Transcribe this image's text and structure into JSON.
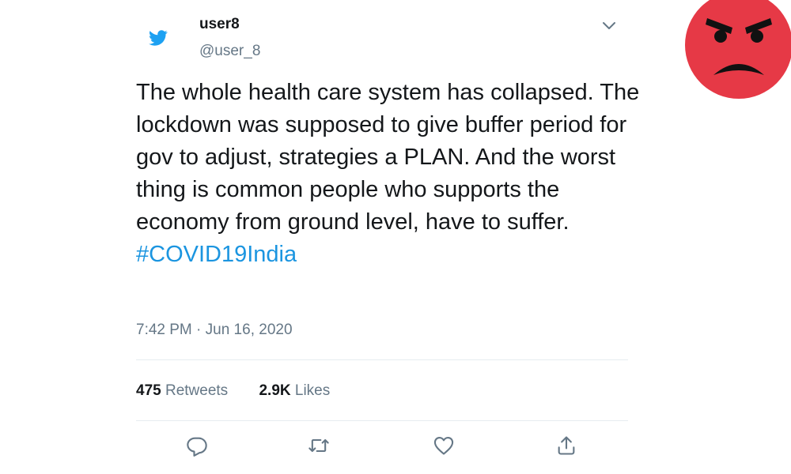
{
  "tweet": {
    "display_name": "user8",
    "handle": "@user_8",
    "text": "The whole health care system has collapsed. The lockdown was supposed to give buffer period for gov to adjust, strategies a PLAN. And the worst thing is common people who supports the economy from ground level, have to suffer.",
    "hashtag": "#COVID19India",
    "timestamp": "7:42 PM · Jun 16, 2020",
    "retweet_count": "475",
    "retweet_label": "Retweets",
    "like_count": "2.9K",
    "like_label": "Likes"
  },
  "icons": {
    "logo": "twitter-bird-icon",
    "menu": "chevron-down-icon",
    "reply": "reply-icon",
    "retweet": "retweet-icon",
    "like": "heart-icon",
    "share": "share-icon",
    "reaction": "angry-face-emoji"
  },
  "colors": {
    "brand": "#1da1f2",
    "hashtag": "#1b95e0",
    "secondary_text": "#657786",
    "divider": "#e6ecf0",
    "emoji_face": "#e63946"
  }
}
